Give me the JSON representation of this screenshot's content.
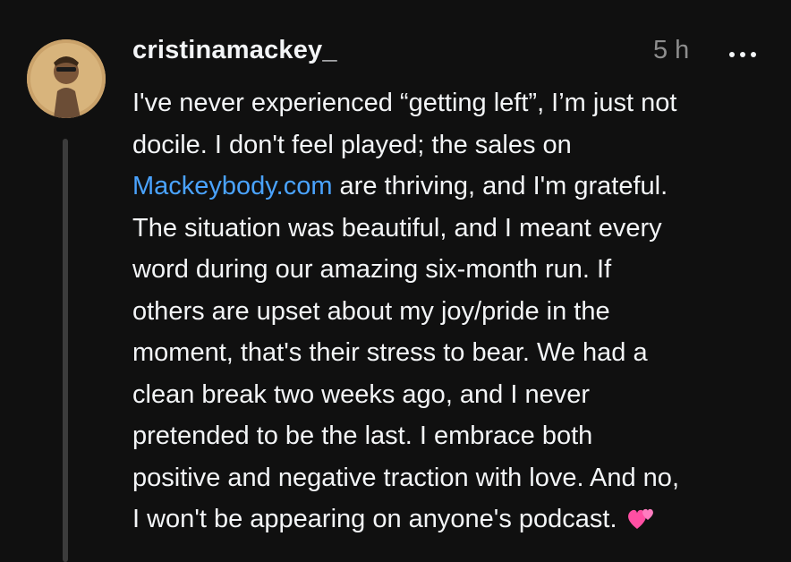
{
  "post": {
    "username": "cristinamackey_",
    "timestamp": "5 h",
    "body": {
      "line1": "I've never experienced “getting left”, I’m just not",
      "line2": "docile. I don't feel played; the sales on",
      "line3_link": "Mackeybody.com",
      "line3_rest": " are thriving, and I'm grateful.",
      "line4": "The situation was beautiful, and I meant every",
      "line5": "word during our amazing six-month run. If",
      "line6": "others are upset about my joy/pride in the",
      "line7": "moment, that's their stress to bear. We had a",
      "line8": "clean break two weeks ago, and I never",
      "line9": "pretended to be the last. I embrace both",
      "line10": "positive and negative traction with love. And no,",
      "line11": "I won't be appearing on anyone's podcast."
    },
    "emoji_icon": "two-hearts-icon",
    "link_color": "#4aa3ff",
    "background_color": "#101010"
  }
}
